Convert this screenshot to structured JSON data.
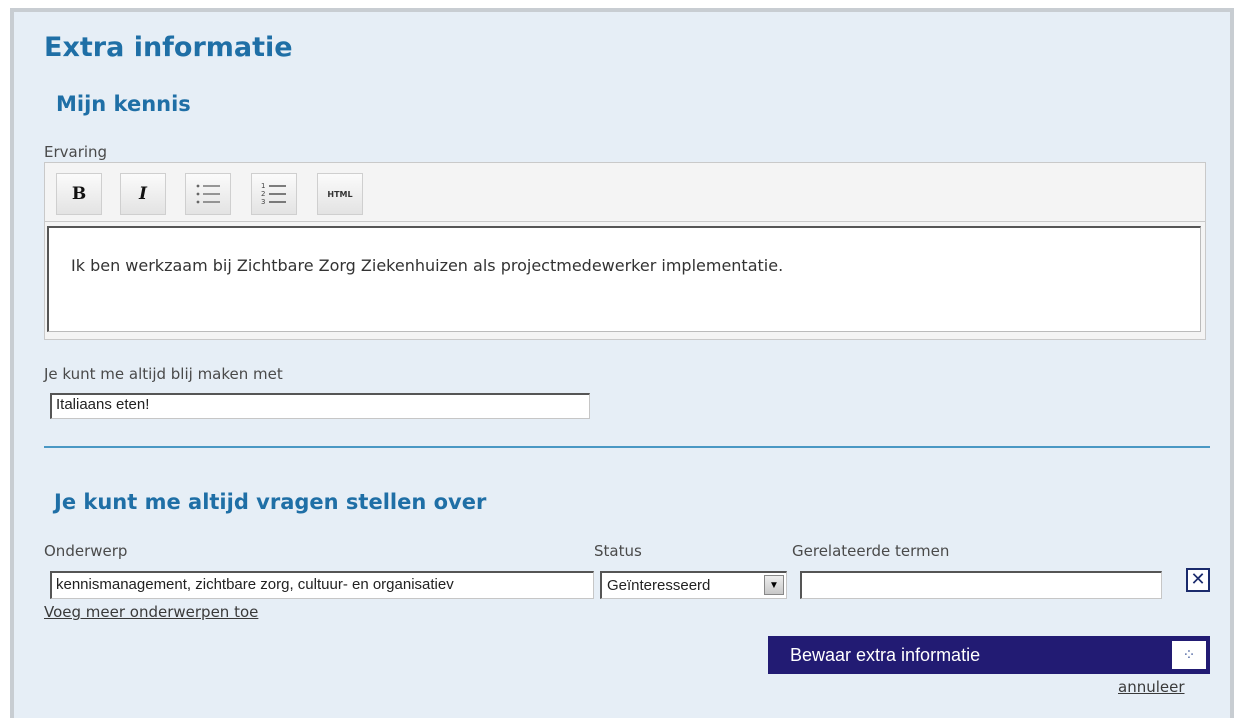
{
  "page": {
    "title": "Extra informatie",
    "section1_title": "Mijn kennis",
    "section2_title": "Je kunt me altijd vragen stellen over"
  },
  "experience": {
    "label": "Ervaring",
    "toolbar": {
      "bold": "B",
      "italic": "I",
      "html": "HTML"
    },
    "text": "Ik ben werkzaam bij Zichtbare Zorg Ziekenhuizen als projectmedewerker implementatie."
  },
  "happy": {
    "label": "Je kunt me altijd blij maken met",
    "value": "Italiaans eten!"
  },
  "topics": {
    "columns": {
      "subject": "Onderwerp",
      "status": "Status",
      "related": "Gerelateerde termen"
    },
    "row": {
      "subject": "kennismanagement, zichtbare zorg, cultuur- en organisatiev",
      "status": "Geïnteresseerd",
      "related": ""
    },
    "add_link": "Voeg meer onderwerpen toe"
  },
  "actions": {
    "save": "Bewaar extra informatie",
    "cancel": "annuleer"
  },
  "colors": {
    "heading": "#1f6fa6",
    "panel_bg": "#e6eef6",
    "save_bg": "#221b73",
    "divider": "#4a98c4"
  },
  "icons": {
    "bullet_list": "unordered-list-icon",
    "numbered_list": "ordered-list-icon",
    "remove": "close-icon",
    "spinner": "loading-icon",
    "dropdown": "chevron-down-icon"
  }
}
